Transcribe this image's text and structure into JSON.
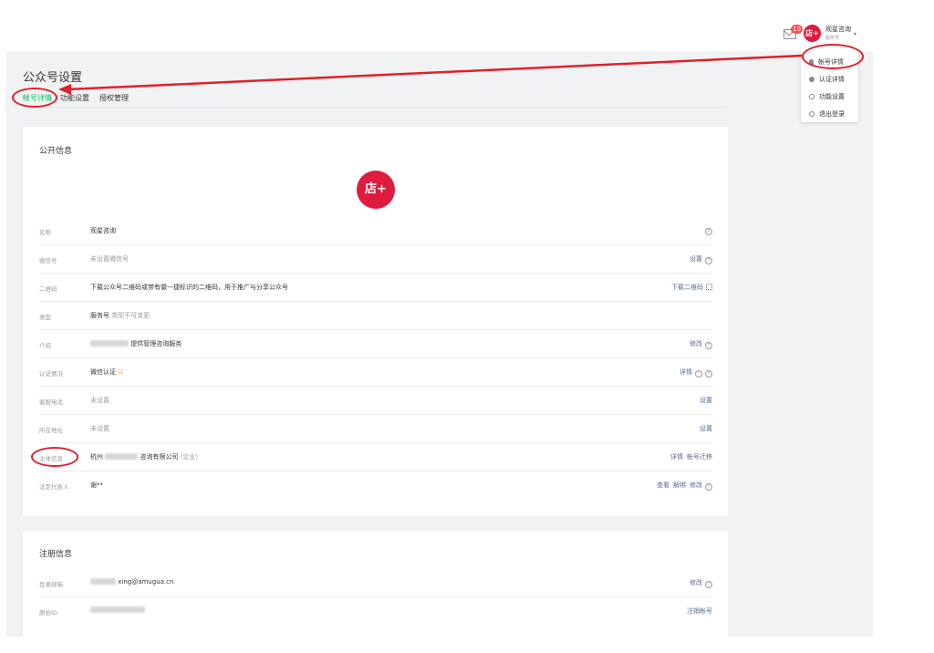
{
  "topbar": {
    "mail_badge": "10",
    "avatar_text": "店+",
    "account_name": "观星咨询",
    "account_type": "服务号"
  },
  "menu": {
    "items": [
      "帐号详情",
      "认证详情",
      "功能设置",
      "退出登录"
    ]
  },
  "page": {
    "title": "公众号设置",
    "tabs": [
      "帐号详情",
      "功能设置",
      "授权管理"
    ],
    "active_tab": 0
  },
  "public_info": {
    "title": "公开信息",
    "logo_text": "店+",
    "rows": [
      {
        "label": "名称",
        "value": "观星咨询",
        "actions": []
      },
      {
        "label": "微信号",
        "value": "未设置微信号",
        "actions": [
          "设置"
        ]
      },
      {
        "label": "二维码",
        "value": "下载公众号二维码或带有徽一捷标识的二维码，用于推广与分享公众号",
        "actions": [
          "下载二维码"
        ]
      },
      {
        "label": "类型",
        "value": "服务号",
        "value_sub": "类型不可变更",
        "actions": []
      },
      {
        "label": "介绍",
        "value": "提供管理咨询服务",
        "actions": [
          "修改"
        ]
      },
      {
        "label": "认证情况",
        "value": "微信认证",
        "actions": [
          "详情"
        ]
      },
      {
        "label": "客服电话",
        "value": "未设置",
        "actions": [
          "设置"
        ]
      },
      {
        "label": "所在地址",
        "value": "未设置",
        "actions": [
          "设置"
        ]
      },
      {
        "label": "主体信息",
        "value_prefix": "杭州",
        "value": "咨询有限公司",
        "value_sub": "(企业)",
        "actions": [
          "详情",
          "帐号迁移"
        ]
      },
      {
        "label": "法定代表人",
        "value": "谢**",
        "actions": [
          "查看",
          "解绑",
          "修改"
        ]
      }
    ]
  },
  "register_info": {
    "title": "注册信息",
    "rows": [
      {
        "label": "登录邮箱",
        "value": "xing@amugua.cn",
        "actions": [
          "修改"
        ]
      },
      {
        "label": "原始ID",
        "value": "",
        "actions": [
          "注销帐号"
        ]
      }
    ]
  },
  "colors": {
    "accent_green": "#07c160",
    "link_blue": "#576b95",
    "brand_red": "#df1c3d",
    "annotation_red": "#e0202a"
  }
}
